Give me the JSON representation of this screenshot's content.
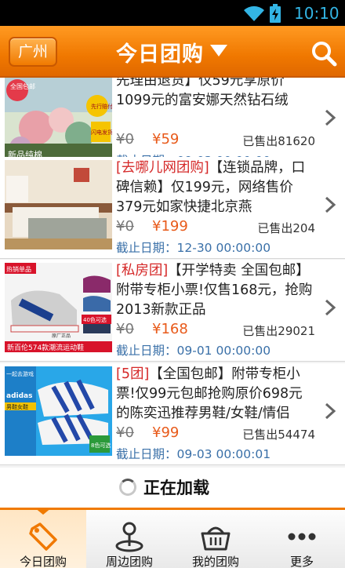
{
  "status_bar": {
    "time": "10:10"
  },
  "header": {
    "city": "广州",
    "title": "今日团购"
  },
  "deals": [
    {
      "desc_source": "",
      "desc_text": "先理由退货】仅59元享原价1099元的富安娜天然钻石绒",
      "orig_price": "¥0",
      "price": "¥59",
      "sold": "已售出81620",
      "deadline": "截止日期：09-03 00:00:00",
      "thumb_texts": [
        "全国包邮",
        "先行赔付",
        "闪电发货",
        "新品纯棉"
      ]
    },
    {
      "desc_source": "[去哪儿网团购]",
      "desc_text": "【连锁品牌，口碑信赖】仅199元，网络售价379元如家快捷北京燕",
      "orig_price": "¥0",
      "price": "¥199",
      "sold": "已售出204",
      "deadline": "截止日期：12-30 00:00:00",
      "thumb_texts": []
    },
    {
      "desc_source": "[私房团]",
      "desc_text": "【开学特卖 全国包邮】附带专柜小票!仅售168元，抢购2013新款正品",
      "orig_price": "¥0",
      "price": "¥168",
      "sold": "已售出29021",
      "deadline": "截止日期：09-01 00:00:00",
      "thumb_texts": [
        "热销单品",
        "40色可选",
        "原厂正品",
        "新百伦574款潮流运动鞋"
      ]
    },
    {
      "desc_source": "[5团]",
      "desc_text": "【全国包邮】附带专柜小票!仅99元包邮抢购原价698元的陈奕迅推荐男鞋/女鞋/情侣",
      "orig_price": "¥0",
      "price": "¥99",
      "sold": "已售出54474",
      "deadline": "截止日期：09-03 00:00:01",
      "thumb_texts": [
        "一起去游戏",
        "adidas",
        "男鞋女鞋",
        "8色可选"
      ]
    }
  ],
  "loading": {
    "text": "正在加载"
  },
  "tabs": [
    {
      "label": "今日团购",
      "icon": "tag-icon"
    },
    {
      "label": "周边团购",
      "icon": "location-pin-icon"
    },
    {
      "label": "我的团购",
      "icon": "basket-icon"
    },
    {
      "label": "更多",
      "icon": "more-dots-icon"
    }
  ],
  "colors": {
    "accent": "#f07800",
    "price": "#e85a1a",
    "deadline": "#3a70a8",
    "source": "#d52828"
  }
}
